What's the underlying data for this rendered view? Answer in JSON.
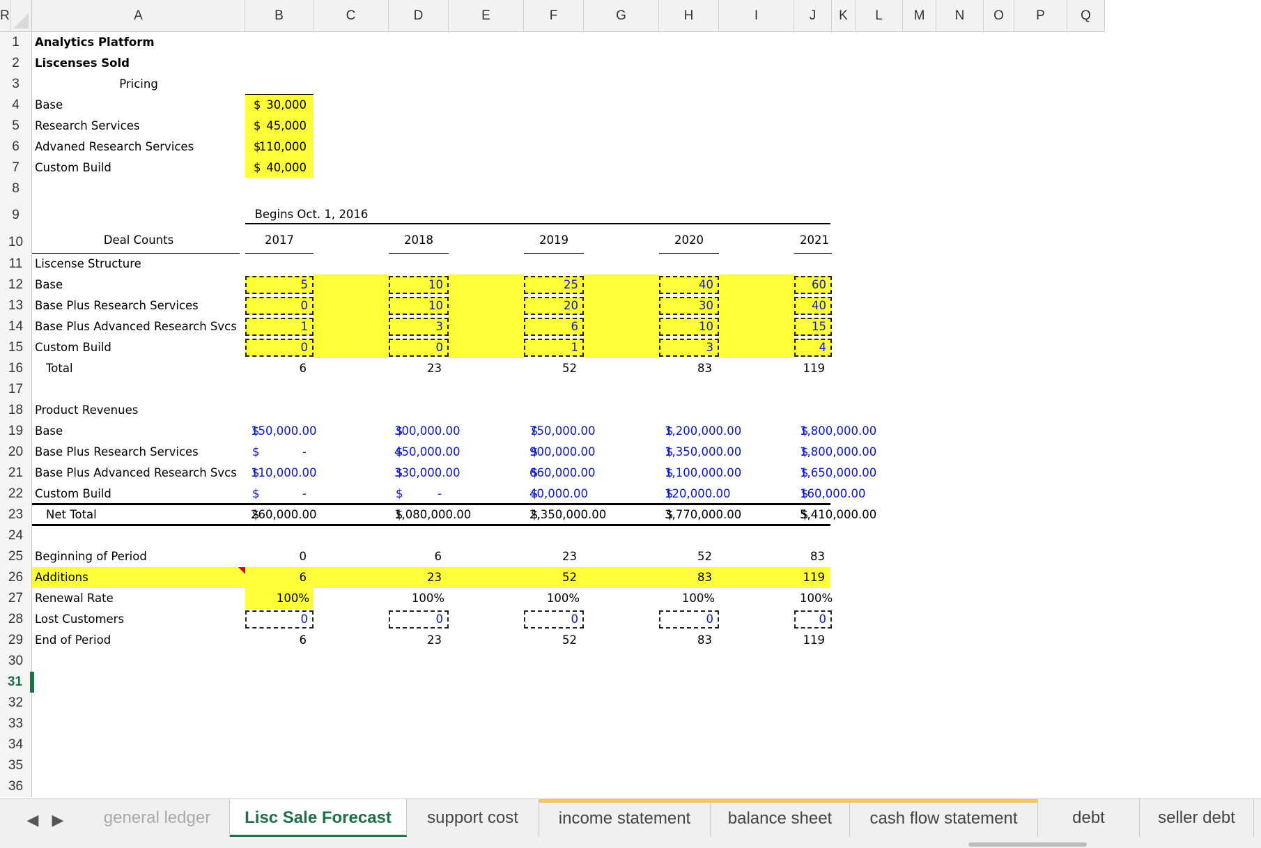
{
  "columns": [
    "A",
    "B",
    "C",
    "D",
    "E",
    "F",
    "G",
    "H",
    "I",
    "J",
    "K",
    "L",
    "M",
    "N",
    "O",
    "P",
    "Q",
    "R"
  ],
  "rows": [
    "1",
    "2",
    "3",
    "4",
    "5",
    "6",
    "7",
    "8",
    "9",
    "10",
    "11",
    "12",
    "13",
    "14",
    "15",
    "16",
    "17",
    "18",
    "19",
    "20",
    "21",
    "22",
    "23",
    "24",
    "25",
    "26",
    "27",
    "28",
    "29",
    "30",
    "31",
    "32",
    "33",
    "34",
    "35",
    "36"
  ],
  "active_row": "31",
  "title": "Analytics Platform",
  "subtitle": "Liscenses Sold",
  "pricing": {
    "header": "Pricing",
    "items": [
      {
        "label": "Base",
        "currency": "$",
        "value": "30,000"
      },
      {
        "label": "Research Services",
        "currency": "$",
        "value": "45,000"
      },
      {
        "label": "Advaned Research Services",
        "currency": "$",
        "value": "110,000"
      },
      {
        "label": "Custom Build",
        "currency": "$",
        "value": "40,000"
      }
    ]
  },
  "begins_note": "Begins Oct. 1, 2016",
  "deal_counts": {
    "header": "Deal Counts",
    "years": [
      "2017",
      "2018",
      "2019",
      "2020",
      "2021"
    ],
    "section_label": "Liscense Structure",
    "rows": [
      {
        "label": "Base",
        "values": [
          "5",
          "10",
          "25",
          "40",
          "60"
        ]
      },
      {
        "label": "Base Plus Research Services",
        "values": [
          "0",
          "10",
          "20",
          "30",
          "40"
        ]
      },
      {
        "label": "Base Plus Advanced Research Svcs",
        "values": [
          "1",
          "3",
          "6",
          "10",
          "15"
        ]
      },
      {
        "label": "Custom Build",
        "values": [
          "0",
          "0",
          "1",
          "3",
          "4"
        ]
      }
    ],
    "total": {
      "label": "Total",
      "values": [
        "6",
        "23",
        "52",
        "83",
        "119"
      ]
    }
  },
  "product_revenues": {
    "header": "Product Revenues",
    "currency": "$",
    "rows": [
      {
        "label": "Base",
        "values": [
          "150,000.00",
          "300,000.00",
          "750,000.00",
          "1,200,000.00",
          "1,800,000.00"
        ]
      },
      {
        "label": "Base Plus Research Services",
        "values": [
          "-",
          "450,000.00",
          "900,000.00",
          "1,350,000.00",
          "1,800,000.00"
        ]
      },
      {
        "label": "Base Plus Advanced Research Svcs",
        "values": [
          "110,000.00",
          "330,000.00",
          "660,000.00",
          "1,100,000.00",
          "1,650,000.00"
        ]
      },
      {
        "label": "Custom Build",
        "values": [
          "-",
          "-",
          "40,000.00",
          "120,000.00",
          "160,000.00"
        ]
      }
    ],
    "net_total": {
      "label": "Net Total",
      "values": [
        "260,000.00",
        "1,080,000.00",
        "2,350,000.00",
        "3,770,000.00",
        "5,410,000.00"
      ]
    }
  },
  "customers": {
    "beginning": {
      "label": "Beginning of Period",
      "values": [
        "0",
        "6",
        "23",
        "52",
        "83"
      ]
    },
    "additions": {
      "label": "Additions",
      "values": [
        "6",
        "23",
        "52",
        "83",
        "119"
      ]
    },
    "renewal": {
      "label": "Renewal Rate",
      "values": [
        "100%",
        "100%",
        "100%",
        "100%",
        "100%"
      ]
    },
    "lost": {
      "label": "Lost Customers",
      "values": [
        "0",
        "0",
        "0",
        "0",
        "0"
      ]
    },
    "end": {
      "label": "End of Period",
      "values": [
        "6",
        "23",
        "52",
        "83",
        "119"
      ]
    }
  },
  "tabs": [
    {
      "label": "general ledger"
    },
    {
      "label": "Lisc Sale Forecast"
    },
    {
      "label": "support cost"
    },
    {
      "label": "income statement"
    },
    {
      "label": "balance sheet"
    },
    {
      "label": "cash flow statement"
    },
    {
      "label": "debt"
    },
    {
      "label": "seller debt"
    }
  ],
  "nav": {
    "prev": "◀",
    "next": "▶"
  },
  "colors": {
    "input_fill": "#ffff37",
    "input_text": "#0b19c9",
    "active_tab": "#1e7145",
    "tab_accent": "#f6c26b"
  }
}
